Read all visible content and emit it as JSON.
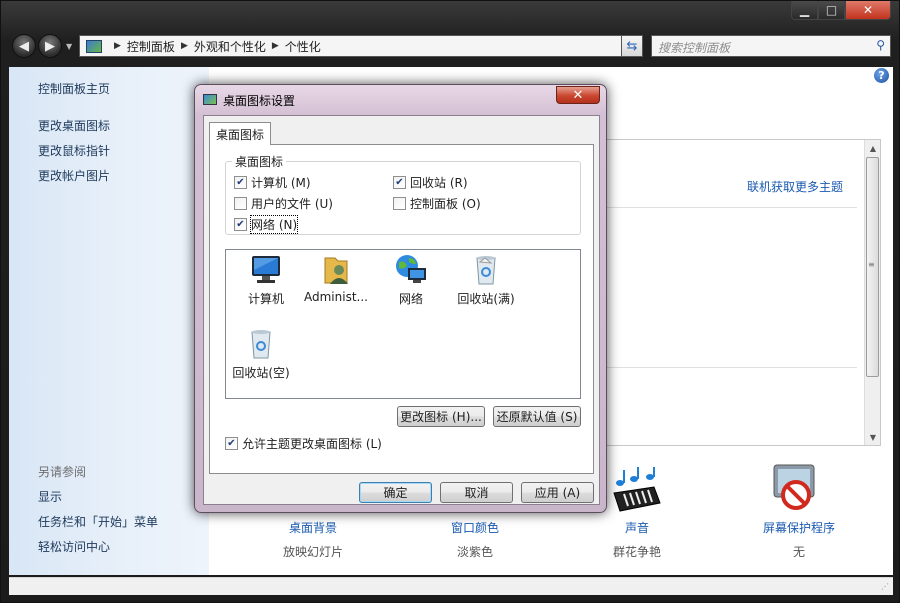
{
  "window": {
    "controls": {
      "minimize": "▁",
      "maximize": "□",
      "close": "✕"
    }
  },
  "address_bar": {
    "breadcrumbs": [
      "控制面板",
      "外观和个性化",
      "个性化"
    ],
    "search_placeholder": "搜索控制面板"
  },
  "sidebar": {
    "links": [
      "控制面板主页",
      "更改桌面图标",
      "更改鼠标指针",
      "更改帐户图片"
    ],
    "see_also_title": "另请参阅",
    "see_also": [
      "显示",
      "任务栏和「开始」菜单",
      "轻松访问中心"
    ]
  },
  "main": {
    "online_themes_link": "联机获取更多主题",
    "bottom_items": [
      {
        "label": "桌面背景",
        "value": "放映幻灯片"
      },
      {
        "label": "窗口颜色",
        "value": "淡紫色"
      },
      {
        "label": "声音",
        "value": "群花争艳"
      },
      {
        "label": "屏幕保护程序",
        "value": "无"
      }
    ]
  },
  "dialog": {
    "title": "桌面图标设置",
    "tab": "桌面图标",
    "group_title": "桌面图标",
    "checkboxes": [
      {
        "label": "计算机 (M)",
        "checked": true
      },
      {
        "label": "回收站 (R)",
        "checked": true
      },
      {
        "label": "用户的文件 (U)",
        "checked": false
      },
      {
        "label": "控制面板 (O)",
        "checked": false
      },
      {
        "label": "网络 (N)",
        "checked": true
      }
    ],
    "icons": [
      "计算机",
      "Administ...",
      "网络",
      "回收站(满)",
      "回收站(空)"
    ],
    "change_icon_button": "更改图标 (H)...",
    "restore_default_button": "还原默认值 (S)",
    "allow_themes_checkbox": {
      "label": "允许主题更改桌面图标 (L)",
      "checked": true
    },
    "ok_button": "确定",
    "cancel_button": "取消",
    "apply_button": "应用 (A)"
  },
  "colors": {
    "link": "#1a5ab0",
    "sidebar_link": "#1e395b",
    "dialog_frame": "#d4c0d4"
  }
}
